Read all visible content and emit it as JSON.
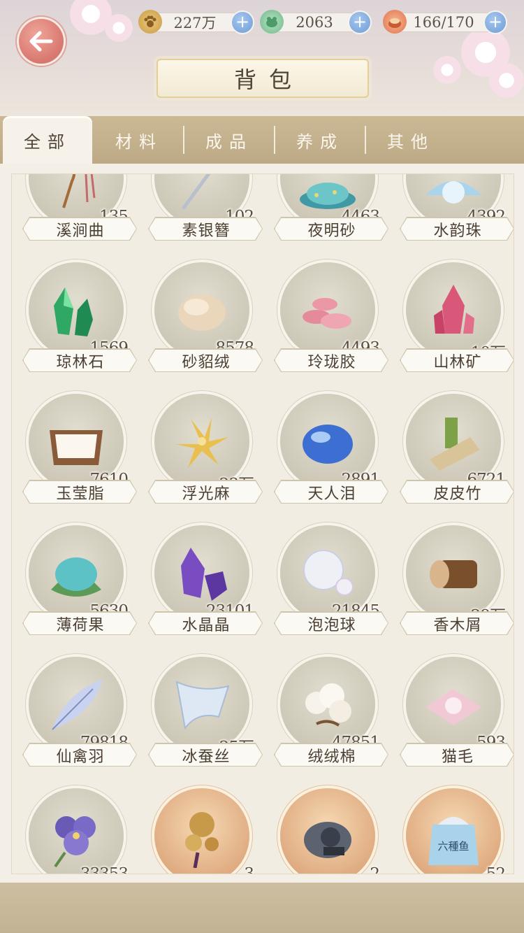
{
  "header": {
    "title": "背包",
    "currencies": [
      {
        "icon": "paw-coin-icon",
        "value": "227万"
      },
      {
        "icon": "jade-frog-icon",
        "value": "2063"
      },
      {
        "icon": "pastry-energy-icon",
        "value": "166/170"
      }
    ]
  },
  "tabs": [
    "全部",
    "材料",
    "成品",
    "养成",
    "其他"
  ],
  "items": [
    {
      "name": "溪涧曲",
      "count": "135",
      "icon": "hairpin-tassel-icon"
    },
    {
      "name": "素银簪",
      "count": "102",
      "icon": "silver-hairpin-icon"
    },
    {
      "name": "夜明砂",
      "count": "4463",
      "icon": "glow-sand-icon"
    },
    {
      "name": "水韵珠",
      "count": "4392",
      "icon": "pearl-shell-icon"
    },
    {
      "name": "琼林石",
      "count": "1569",
      "icon": "green-crystal-icon"
    },
    {
      "name": "砂貂绒",
      "count": "8578",
      "icon": "fur-ball-icon"
    },
    {
      "name": "玲珑胶",
      "count": "4493",
      "icon": "pink-mushroom-icon"
    },
    {
      "name": "山林矿",
      "count": "10万",
      "icon": "pink-crystal-icon"
    },
    {
      "name": "玉莹脂",
      "count": "7610",
      "icon": "cream-box-icon"
    },
    {
      "name": "浮光麻",
      "count": "23万",
      "icon": "yellow-flower-icon"
    },
    {
      "name": "天人泪",
      "count": "2891",
      "icon": "blue-gem-icon"
    },
    {
      "name": "皮皮竹",
      "count": "6721",
      "icon": "bamboo-icon"
    },
    {
      "name": "薄荷果",
      "count": "5630",
      "icon": "mint-fruit-icon"
    },
    {
      "name": "水晶晶",
      "count": "23101",
      "icon": "purple-crystal-icon"
    },
    {
      "name": "泡泡球",
      "count": "21845",
      "icon": "bubble-icon"
    },
    {
      "name": "香木屑",
      "count": "29万",
      "icon": "wood-log-icon"
    },
    {
      "name": "仙禽羽",
      "count": "79818",
      "icon": "feather-icon"
    },
    {
      "name": "冰蚕丝",
      "count": "25万",
      "icon": "silk-icon"
    },
    {
      "name": "绒绒棉",
      "count": "47851",
      "icon": "cotton-icon"
    },
    {
      "name": "猫毛",
      "count": "593",
      "icon": "cat-hair-icon"
    },
    {
      "name": "",
      "count": "33353",
      "icon": "pansy-flower-icon"
    },
    {
      "name": "",
      "count": "3",
      "icon": "gold-ornament-icon"
    },
    {
      "name": "",
      "count": "2",
      "icon": "stone-mold-icon"
    },
    {
      "name": "",
      "count": "52",
      "icon": "fish-bag-icon"
    }
  ],
  "bag_label": "六種鱼",
  "colors": {
    "tab_bar": "#c4b08c",
    "accent_blue": "#6e9ed6",
    "back_button": "#d8776e"
  }
}
